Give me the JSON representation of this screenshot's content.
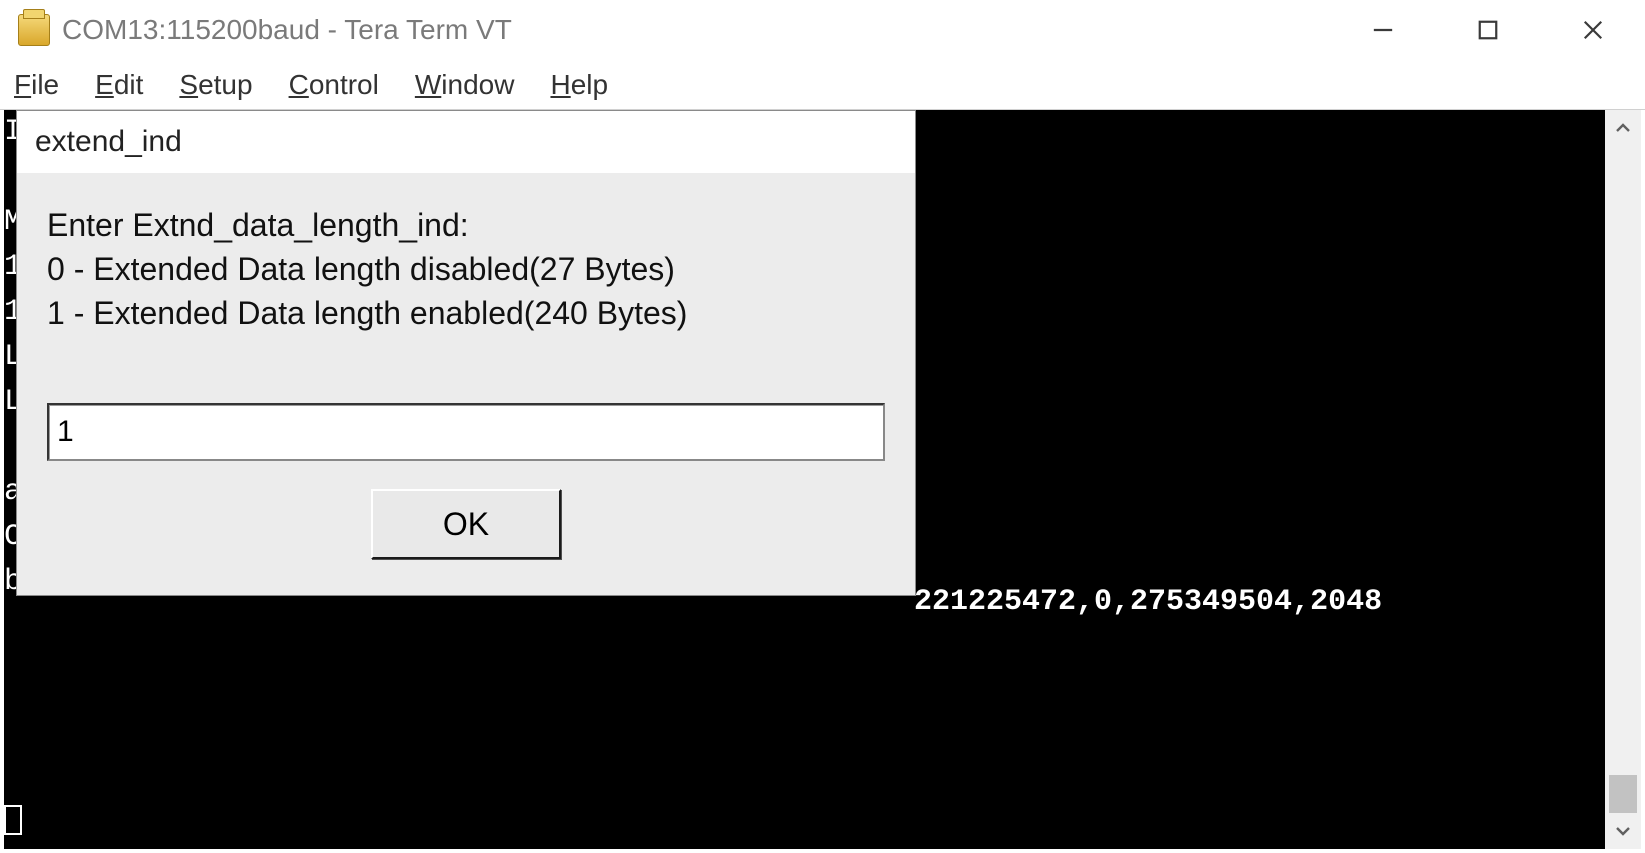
{
  "window": {
    "title": "COM13:115200baud - Tera Term VT"
  },
  "menu": {
    "items": [
      {
        "label": "File",
        "accel_index": 0
      },
      {
        "label": "Edit",
        "accel_index": 0
      },
      {
        "label": "Setup",
        "accel_index": 0
      },
      {
        "label": "Control",
        "accel_index": 0
      },
      {
        "label": "Window",
        "accel_index": 0
      },
      {
        "label": "Help",
        "accel_index": 0
      }
    ]
  },
  "terminal": {
    "left_edge_chars": [
      "I",
      "",
      "M",
      "1",
      "1",
      "L",
      "L",
      "",
      "a",
      "C",
      "b"
    ],
    "visible_line": "221225472,0,275349504,2048"
  },
  "dialog": {
    "title": "extend_ind",
    "body_lines": [
      "Enter Extnd_data_length_ind:",
      " 0 - Extended Data length disabled(27 Bytes)",
      " 1 - Extended Data length enabled(240 Bytes)"
    ],
    "input_value": "1",
    "ok_label": "OK"
  }
}
